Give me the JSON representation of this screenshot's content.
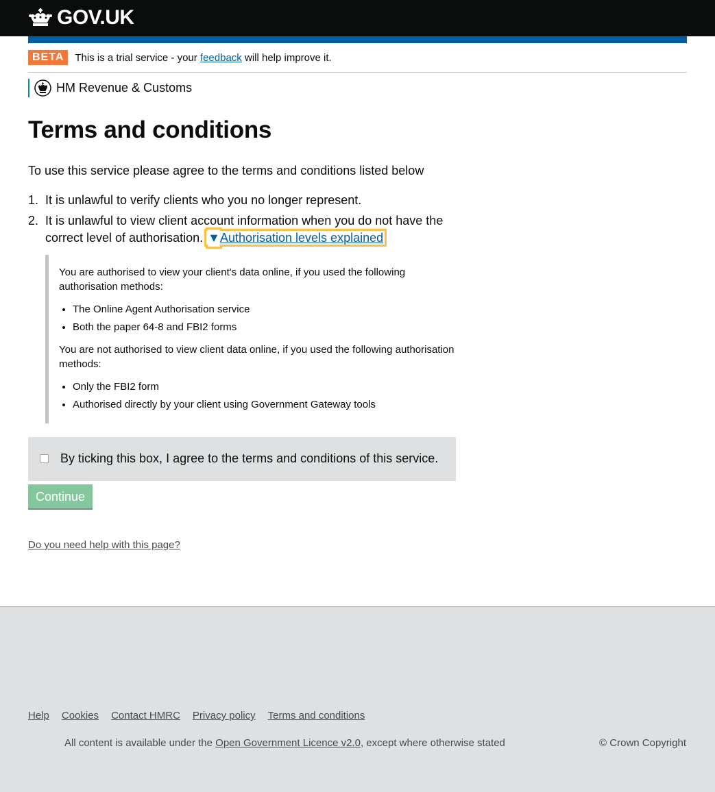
{
  "header": {
    "logo_text": "GOV.UK",
    "crown_icon": "crown-icon"
  },
  "beta_banner": {
    "tag": "BETA",
    "text_before": "This is a trial service - your",
    "link": "feedback",
    "text_after": "will help improve it."
  },
  "organisation": {
    "name": "HM Revenue & Customs"
  },
  "main": {
    "title": "Terms and conditions",
    "intro": "To use this service please agree to the terms and conditions listed below",
    "terms": [
      {
        "number": "1.",
        "text": "It is unlawful to verify clients who you no longer represent."
      },
      {
        "number": "2.",
        "text": "It is unlawful to view client account information when you do not have the correct level of authorisation."
      }
    ],
    "details": {
      "marker": "▼",
      "summary": "Authorisation levels explained",
      "authorised_intro": "You are authorised to view your client's data online, if you used the following authorisation methods:",
      "authorised_items": [
        "The Online Agent Authorisation service",
        "Both the paper 64-8 and FBI2 forms"
      ],
      "not_authorised_intro": "You are not authorised to view client data online, if you used the following authorisation methods:",
      "not_authorised_items": [
        "Only the FBI2 form",
        "Authorised directly by your client using Government Gateway tools"
      ]
    },
    "agree_label": "By ticking this box, I agree to the terms and conditions of this service.",
    "agree_checked": false,
    "continue_button": "Continue",
    "help_link": "Do you need help with this page?"
  },
  "footer": {
    "links": [
      "Help",
      "Cookies",
      "Contact HMRC",
      "Privacy policy",
      "Terms and conditions"
    ],
    "licence_before": "All content is available under the",
    "licence_link": "Open Government Licence v2.0",
    "licence_after": ", except where otherwise stated",
    "copyright": "© Crown Copyright"
  },
  "colors": {
    "header_bg": "#0b0c0c",
    "blue_bar": "#005ea5",
    "beta_tag": "#f47738",
    "link": "#005ea5",
    "focus": "#ffbf47",
    "button_disabled": "#85c79c",
    "footer_bg": "#dee0e2"
  }
}
